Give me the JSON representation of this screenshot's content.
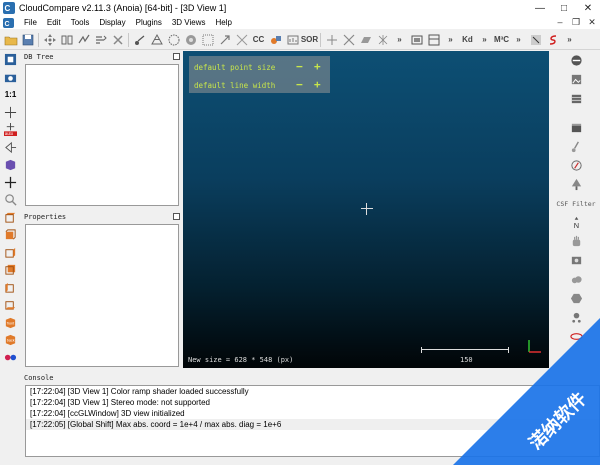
{
  "window": {
    "title": "CloudCompare v2.11.3 (Anoia) [64-bit] - [3D View 1]",
    "minimize": "—",
    "maximize": "□",
    "close": "✕"
  },
  "menu": {
    "items": [
      "File",
      "Edit",
      "Tools",
      "Display",
      "Plugins",
      "3D Views",
      "Help"
    ],
    "mdi_buttons": [
      "–",
      "❐",
      "✕"
    ]
  },
  "toolbar": {
    "text_sor": "SOR",
    "text_cc": "CC",
    "text_kd": "Kd",
    "text_m2c": "M³C",
    "more": "»"
  },
  "left_toolbar": {
    "one_to_one": "1:1",
    "auto": "auto"
  },
  "panels": {
    "db_tree": "DB Tree",
    "properties": "Properties",
    "console": "Console"
  },
  "view3d": {
    "point_size_label": "default point size",
    "line_width_label": "default line width",
    "minus": "−",
    "plus": "+",
    "new_size_text": "New size = 628 * 548 (px)",
    "scale_value": "150"
  },
  "right_toolbar": {
    "csf_filter": "CSF Filter",
    "n_label": "N"
  },
  "console": {
    "lines": [
      "[17:22:04] [3D View 1] Color ramp shader loaded successfully",
      "[17:22:04] [3D View 1] Stereo mode: not supported",
      "[17:22:04] [ccGLWindow] 3D view initialized",
      "[17:22:05] [Global Shift] Max abs. coord = 1e+4 / max abs. diag = 1e+6"
    ]
  },
  "watermark": {
    "text": "渃纳软件"
  },
  "colors": {
    "view_top": "#0d4f74",
    "view_bottom": "#010507",
    "overlay_text": "#c8e64a",
    "watermark_blue": "#1a73e8"
  }
}
